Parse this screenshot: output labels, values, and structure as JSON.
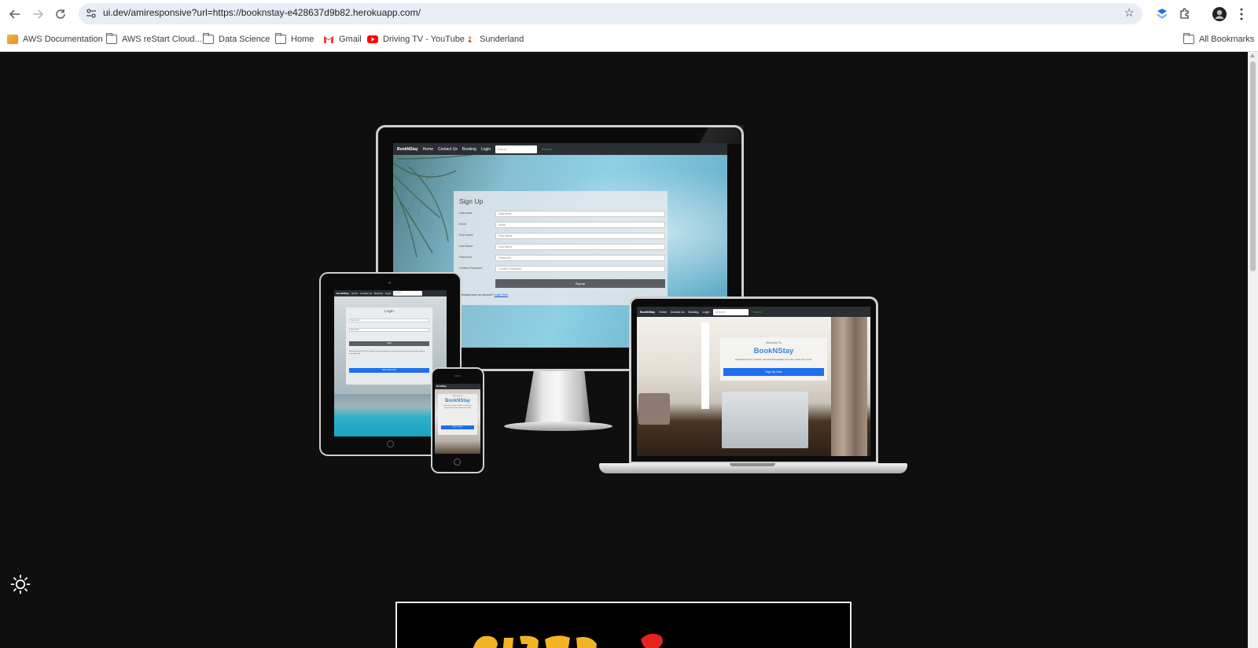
{
  "browser": {
    "url": "ui.dev/amiresponsive?url=https://booknstay-e428637d9b82.herokuapp.com/",
    "bookmarks": [
      {
        "label": "AWS Documentation",
        "icon": "aws-docs-icon"
      },
      {
        "label": "AWS reStart Cloud...",
        "icon": "folder-icon"
      },
      {
        "label": "Data Science",
        "icon": "folder-icon"
      },
      {
        "label": "Home",
        "icon": "folder-icon"
      },
      {
        "label": "Gmail",
        "icon": "gmail-icon"
      },
      {
        "label": "Driving TV - YouTube",
        "icon": "youtube-icon"
      },
      {
        "label": "Sunderland",
        "icon": "sunderland-icon"
      }
    ],
    "all_bookmarks": "All Bookmarks"
  },
  "site": {
    "brand": "BookNStay",
    "nav": [
      "Home",
      "Contact Us",
      "Booking",
      "Login"
    ],
    "search_placeholder": "Search",
    "search_button": "Search"
  },
  "monitor": {
    "title": "Sign Up",
    "fields": [
      {
        "label": "Username",
        "placeholder": "Username"
      },
      {
        "label": "Email",
        "placeholder": "Email"
      },
      {
        "label": "First Name",
        "placeholder": "First Name"
      },
      {
        "label": "Last Name",
        "placeholder": "Last Name"
      },
      {
        "label": "Password",
        "placeholder": "Password"
      },
      {
        "label": "Confirm Password",
        "placeholder": "Confirm Password"
      }
    ],
    "button": "Signup",
    "footer_text": "Already have an account?",
    "footer_link": "Login Here"
  },
  "tablet": {
    "title": "Login",
    "fields": [
      "Username",
      "Password"
    ],
    "button": "Login",
    "forgot_text": "Forgot password? Please contact us for help with your account and we will assist you with resetting your password.",
    "reset_button": "Reset Password"
  },
  "laptop": {
    "welcome": "Welcome To",
    "brand": "BookNStay",
    "tagline": "Experience luxury, comfort, exceptional hospitality and more--Away from home",
    "cta": "Sign Up Now"
  },
  "phone": {
    "welcome": "Welcome To",
    "brand": "BookNStay",
    "tagline": "Experience luxury, comfort, exceptional hospitality and more--Away from home",
    "cta": "Sign Up Now"
  },
  "colors": {
    "page_background": "#0f0f10",
    "accent_blue": "#1d6ff2",
    "brand_blue": "#3b86d6",
    "navbar": "#2b2f33"
  }
}
